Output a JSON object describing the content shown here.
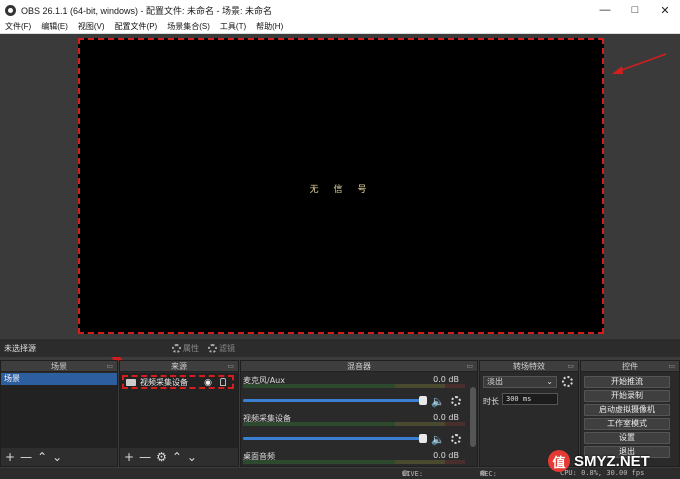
{
  "window": {
    "title": "OBS 26.1.1 (64-bit, windows) - 配置文件: 未命名 - 场景: 未命名"
  },
  "menu": [
    "文件(F)",
    "编辑(E)",
    "视图(V)",
    "配置文件(P)",
    "场景集合(S)",
    "工具(T)",
    "帮助(H)"
  ],
  "preview": {
    "no_signal": "无 信 号"
  },
  "toolbar": {
    "no_source": "未选择源",
    "properties": "属性",
    "filters": "滤镜"
  },
  "docks": {
    "scenes": {
      "title": "场景",
      "items": [
        "场景"
      ]
    },
    "sources": {
      "title": "来源",
      "items": [
        "视频采集设备"
      ]
    },
    "mixer": {
      "title": "混音器",
      "channels": [
        {
          "name": "麦克风/Aux",
          "db": "0.0 dB"
        },
        {
          "name": "视频采集设备",
          "db": "0.0 dB"
        },
        {
          "name": "桌面音频",
          "db": "0.0 dB"
        }
      ]
    },
    "transitions": {
      "title": "转场特效",
      "selected": "淡出",
      "duration_label": "时长",
      "duration_value": "300 ms"
    },
    "controls": {
      "title": "控件",
      "buttons": [
        "开始推流",
        "开始录制",
        "启动虚拟摄像机",
        "工作室模式",
        "设置",
        "退出"
      ]
    }
  },
  "status": {
    "live": "LIVE: 00:00:00",
    "rec": "REC: 00:00:00",
    "cpu": "CPU: 0.8%, 30.00 fps"
  },
  "watermark": {
    "logo": "值",
    "text": "SMYZ.NET"
  },
  "colors": {
    "highlight": "#d41e1e",
    "selection": "#2d5fa0",
    "slider": "#3a7fd0"
  }
}
